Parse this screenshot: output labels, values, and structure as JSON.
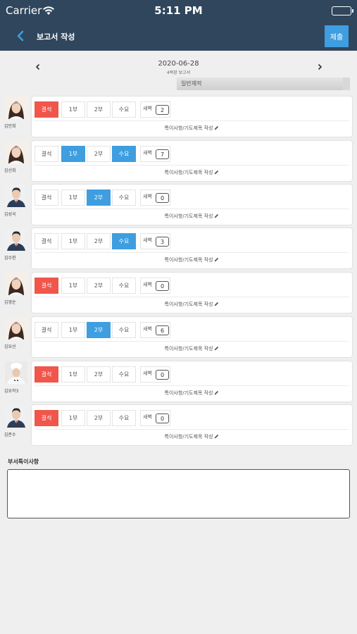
{
  "status_bar": {
    "carrier": "Carrier",
    "time": "5:11 PM"
  },
  "nav": {
    "title": "보고서 작성",
    "submit": "제출"
  },
  "date_bar": {
    "date": "2020-06-28",
    "subtitle": "4목장 보고서"
  },
  "dropdown": {
    "selected": "일반재적"
  },
  "labels": {
    "absent": "결석",
    "part1": "1부",
    "part2": "2부",
    "wed": "수요",
    "dawn": "새벽",
    "note": "특이사항/기도제목 작성"
  },
  "members": [
    {
      "name": "김민희",
      "active": [
        "absent"
      ],
      "dawn": "2",
      "avatar": "woman"
    },
    {
      "name": "김선희",
      "active": [
        "part1",
        "wed"
      ],
      "dawn": "7",
      "avatar": "woman"
    },
    {
      "name": "김성국",
      "active": [
        "part2"
      ],
      "dawn": "0",
      "avatar": "man"
    },
    {
      "name": "김수현",
      "active": [
        "wed"
      ],
      "dawn": "3",
      "avatar": "man"
    },
    {
      "name": "김영순",
      "active": [
        "absent"
      ],
      "dawn": "0",
      "avatar": "woman"
    },
    {
      "name": "김요선",
      "active": [
        "part2"
      ],
      "dawn": "6",
      "avatar": "woman"
    },
    {
      "name": "김요작3",
      "active": [
        "absent"
      ],
      "dawn": "0",
      "avatar": "chef"
    },
    {
      "name": "김준수",
      "active": [
        "absent"
      ],
      "dawn": "0",
      "avatar": "man"
    }
  ],
  "remarks": {
    "label": "부서특이사항",
    "value": ""
  },
  "colors": {
    "header": "#30465c",
    "accent_blue": "#3e9ee0",
    "absent_red": "#f0564b"
  }
}
